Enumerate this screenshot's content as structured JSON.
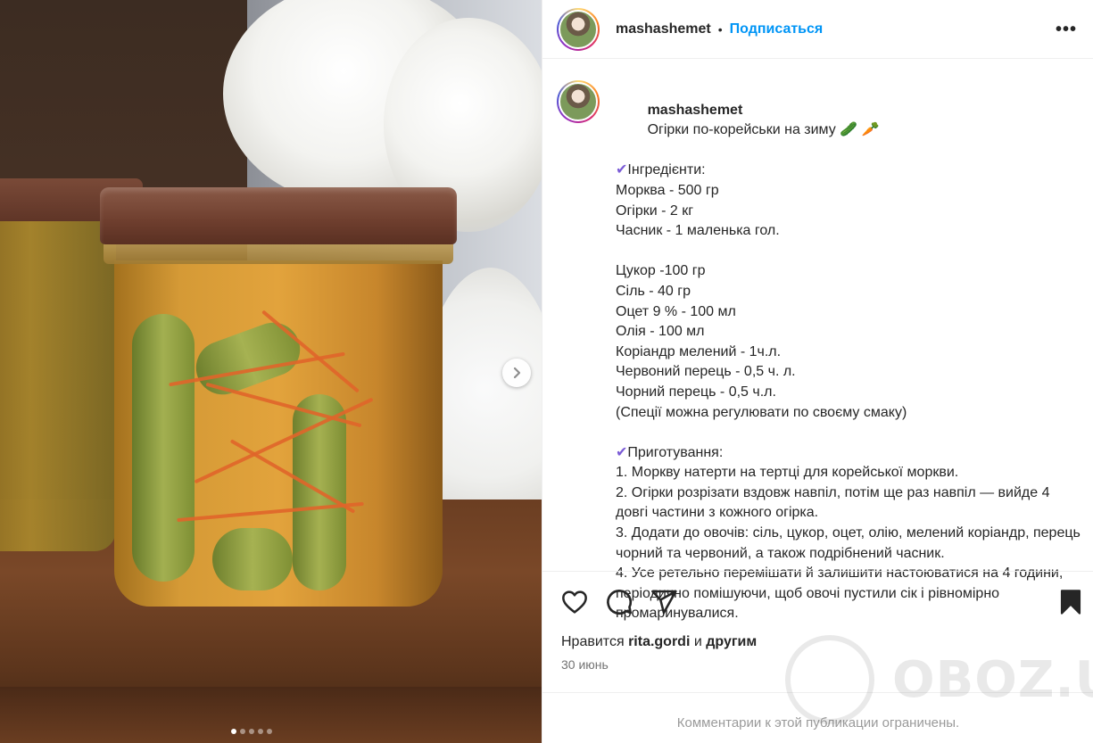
{
  "post": {
    "username": "mashashemet",
    "separator": "•",
    "follow_label": "Подписаться",
    "more_label": "•••"
  },
  "caption": {
    "username": "mashashemet",
    "title": "Огірки по-корейськи на зиму 🥒 🥕",
    "lines": [
      "✔Інгредієнти:",
      "Морква - 500 гр",
      "Огірки - 2 кг",
      "Часник - 1 маленька гол.",
      "",
      "Цукор -100 гр",
      "Сіль - 40 гр",
      "Оцет 9 % - 100 мл",
      "Олія - 100 мл",
      "Коріандр мелений - 1ч.л.",
      "Червоний перець - 0,5 ч. л.",
      "Чорний перець - 0,5 ч.л.",
      "(Спеції можна регулювати по своєму смаку)",
      "",
      "✔Приготування:",
      "1. Моркву натерти на тертці для корейської моркви.",
      "2. Огірки розрізати вздовж навпіл, потім ще раз навпіл — вийде 4 довгі частини з кожного огірка.",
      "3. Додати до овочів: сіль, цукор, оцет, олію, мелений коріандр, перець чорний та червоний, а також подрібнений часник.",
      "4. Усе ретельно перемішати й залишити настоюватися на 4 години, періодично помішуючи, щоб овочі пустили сік і рівномірно промаринувалися."
    ]
  },
  "likes": {
    "prefix": "Нравится",
    "user": "rita.gordi",
    "connector": "и",
    "suffix": "другим"
  },
  "date": "30 июнь",
  "comments_notice": "Комментарии к этой публикации ограничены.",
  "watermark": "OBOZ.UA",
  "carousel": {
    "total": 5,
    "active": 1
  },
  "colors": {
    "accent": "#0095f6",
    "text": "#262626",
    "muted": "#737373"
  }
}
